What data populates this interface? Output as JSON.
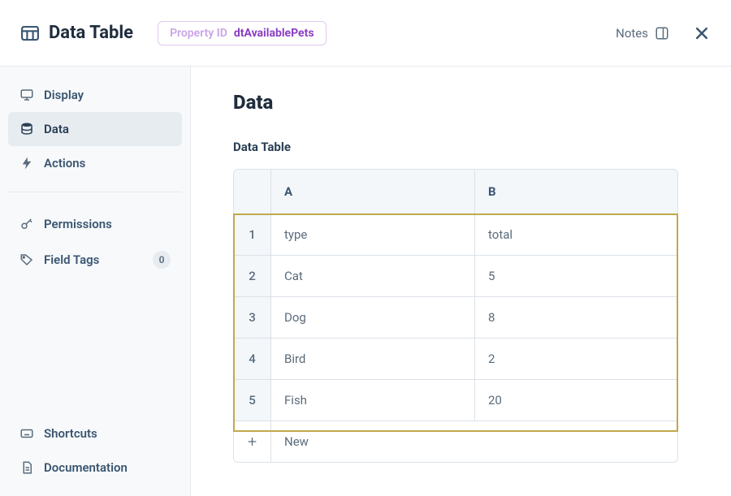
{
  "header": {
    "title": "Data Table",
    "property_label": "Property ID",
    "property_value": "dtAvailablePets",
    "notes_label": "Notes"
  },
  "sidebar": {
    "group1": [
      {
        "label": "Display"
      },
      {
        "label": "Data"
      },
      {
        "label": "Actions"
      }
    ],
    "group2": [
      {
        "label": "Permissions"
      },
      {
        "label": "Field Tags",
        "badge": "0"
      }
    ],
    "footer": [
      {
        "label": "Shortcuts"
      },
      {
        "label": "Documentation"
      }
    ],
    "selected": "Data"
  },
  "main": {
    "title": "Data",
    "section_label": "Data Table",
    "columns": [
      "A",
      "B"
    ],
    "rows": [
      {
        "n": "1",
        "a": "type",
        "b": "total"
      },
      {
        "n": "2",
        "a": "Cat",
        "b": "5"
      },
      {
        "n": "3",
        "a": "Dog",
        "b": "8"
      },
      {
        "n": "4",
        "a": "Bird",
        "b": "2"
      },
      {
        "n": "5",
        "a": "Fish",
        "b": "20"
      }
    ],
    "new_label": "New"
  },
  "chart_data": {
    "type": "table",
    "columns": [
      "A",
      "B"
    ],
    "rows": [
      [
        "type",
        "total"
      ],
      [
        "Cat",
        "5"
      ],
      [
        "Dog",
        "8"
      ],
      [
        "Bird",
        "2"
      ],
      [
        "Fish",
        "20"
      ]
    ]
  }
}
